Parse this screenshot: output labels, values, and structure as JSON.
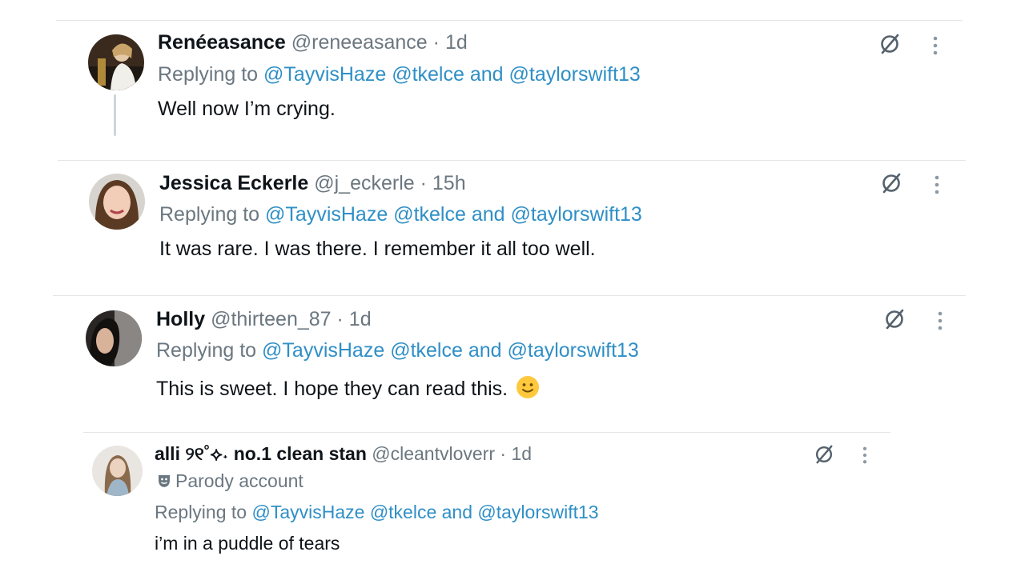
{
  "colors": {
    "link": "#2f8fc6",
    "meta": "#6b7780",
    "text": "#0f1419",
    "divider": "#e3e6e9"
  },
  "replies": [
    {
      "display_name": "Renéeasance",
      "handle": "@reneeasance",
      "separator": "·",
      "time": "1d",
      "replying_prefix": "Replying to",
      "mentions": [
        "@TayvisHaze",
        "@tkelce"
      ],
      "and_word": "and",
      "last_mention": "@taylorswift13",
      "text": "Well now I’m crying.",
      "icons": [
        "grok-slash-icon",
        "more-icon"
      ]
    },
    {
      "display_name": "Jessica Eckerle",
      "handle": "@j_eckerle",
      "separator": "·",
      "time": "15h",
      "replying_prefix": "Replying to",
      "mentions": [
        "@TayvisHaze",
        "@tkelce"
      ],
      "and_word": "and",
      "last_mention": "@taylorswift13",
      "text": "It was rare. I was there. I remember it all too well.",
      "icons": [
        "grok-slash-icon",
        "more-icon"
      ]
    },
    {
      "display_name": "Holly",
      "handle": "@thirteen_87",
      "separator": "·",
      "time": "1d",
      "replying_prefix": "Replying to",
      "mentions": [
        "@TayvisHaze",
        "@tkelce"
      ],
      "and_word": "and",
      "last_mention": "@taylorswift13",
      "text": "This is sweet. I hope they can read this.",
      "emoji": "slightly-smiling-face-icon",
      "icons": [
        "grok-slash-icon",
        "more-icon"
      ]
    },
    {
      "display_name": "alli ୨୧˚⟡˖ no.1 clean stan",
      "handle": "@cleantvloverr",
      "separator": "·",
      "time": "1d",
      "label": "Parody account",
      "label_icon": "parody-mask-icon",
      "replying_prefix": "Replying to",
      "mentions": [
        "@TayvisHaze",
        "@tkelce"
      ],
      "and_word": "and",
      "last_mention": "@taylorswift13",
      "text": "i’m in a puddle of tears",
      "icons": [
        "grok-slash-icon",
        "more-icon"
      ]
    }
  ]
}
